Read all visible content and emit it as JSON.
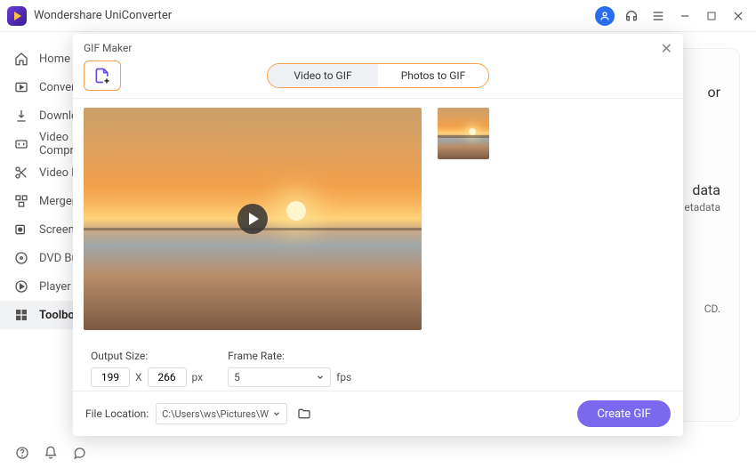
{
  "app": {
    "title": "Wondershare UniConverter"
  },
  "sidebar": {
    "items": [
      {
        "label": "Home"
      },
      {
        "label": "Converter"
      },
      {
        "label": "Downloader"
      },
      {
        "label": "Video Compressor"
      },
      {
        "label": "Video Editor"
      },
      {
        "label": "Merger"
      },
      {
        "label": "Screen Recorder"
      },
      {
        "label": "DVD Burner"
      },
      {
        "label": "Player"
      },
      {
        "label": "Toolbox"
      }
    ]
  },
  "background": {
    "peek1": "or",
    "peek2": "data",
    "peek3": "etadata",
    "peek4": "CD."
  },
  "modal": {
    "title": "GIF Maker",
    "tabs": {
      "video": "Video to GIF",
      "photos": "Photos to GIF"
    },
    "output_size_label": "Output Size:",
    "width": "199",
    "height": "266",
    "px": "px",
    "times": "X",
    "frame_rate_label": "Frame Rate:",
    "frame_rate_value": "5",
    "fps": "fps",
    "file_location_label": "File Location:",
    "file_location_value": "C:\\Users\\ws\\Pictures\\Wonders",
    "create": "Create GIF"
  }
}
